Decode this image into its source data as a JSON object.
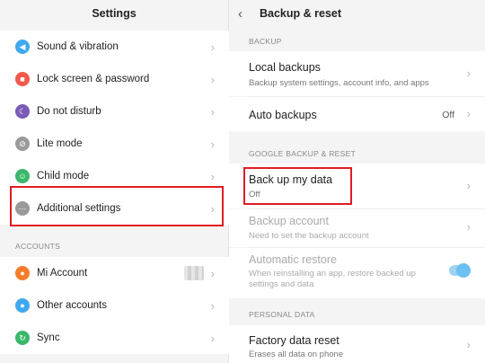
{
  "left": {
    "title": "Settings",
    "items": [
      {
        "label": "Sound & vibration",
        "icon": "speaker-icon",
        "color": "#3fa8ee"
      },
      {
        "label": "Lock screen & password",
        "icon": "lock-icon",
        "color": "#ef5a4c"
      },
      {
        "label": "Do not disturb",
        "icon": "moon-icon",
        "color": "#7a5bb5"
      },
      {
        "label": "Lite mode",
        "icon": "lite-mode-icon",
        "color": "#9a9a9a"
      },
      {
        "label": "Child mode",
        "icon": "child-icon",
        "color": "#3bb86b"
      },
      {
        "label": "Additional settings",
        "icon": "more-dots-icon",
        "color": "#9a9a9a"
      }
    ],
    "accounts_header": "ACCOUNTS",
    "account_items": [
      {
        "label": "Mi Account",
        "icon": "mi-account-icon",
        "color": "#f57c2b"
      },
      {
        "label": "Other accounts",
        "icon": "person-icon",
        "color": "#3fa8ee"
      },
      {
        "label": "Sync",
        "icon": "sync-icon",
        "color": "#3bb86b"
      }
    ]
  },
  "right": {
    "title": "Backup & reset",
    "backup_header": "BACKUP",
    "local_backups": {
      "title": "Local backups",
      "subtitle": "Backup system settings, account info, and apps"
    },
    "auto_backups": {
      "title": "Auto backups",
      "value": "Off"
    },
    "google_header": "GOOGLE BACKUP & RESET",
    "back_up_my_data": {
      "title": "Back up my data",
      "subtitle": "Off"
    },
    "backup_account": {
      "title": "Backup account",
      "subtitle": "Need to set the backup account"
    },
    "automatic_restore": {
      "title": "Automatic restore",
      "subtitle_line1": "When reinstalling an app, restore backed up",
      "subtitle_line2": "settings and data",
      "enabled": true
    },
    "personal_header": "PERSONAL DATA",
    "factory_reset": {
      "title": "Factory data reset",
      "subtitle": "Erases all data on phone"
    }
  },
  "colors": {
    "highlight": "#e01b24",
    "toggle_on": "#6cc0f2"
  }
}
